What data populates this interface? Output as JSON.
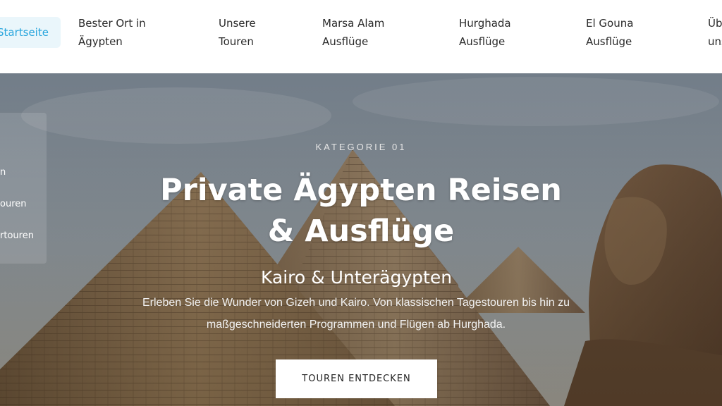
{
  "nav": {
    "home": "Startseite",
    "items": [
      {
        "line1": "Bester Ort in",
        "line2": "Ägypten"
      },
      {
        "line1": "Unsere",
        "line2": "Touren"
      },
      {
        "line1": "Marsa Alam",
        "line2": "Ausflüge"
      },
      {
        "line1": "Hurghada",
        "line2": "Ausflüge"
      },
      {
        "line1": "El Gouna",
        "line2": "Ausflüge"
      },
      {
        "line1": "Üb",
        "line2": "uns"
      }
    ]
  },
  "side_panel": {
    "items": [
      "n",
      "ouren",
      "rtouren"
    ]
  },
  "hero": {
    "kicker": "KATEGORIE 01",
    "title": "Private Ägypten Reisen & Ausflüge",
    "subtitle": "Kairo & Unterägypten",
    "description": "Erleben Sie die Wunder von Gizeh und Kairo. Von klassischen Tagestouren bis hin zu maßgeschneiderten Programmen und Flügen ab Hurghada.",
    "cta_label": "TOUREN ENTDECKEN"
  }
}
